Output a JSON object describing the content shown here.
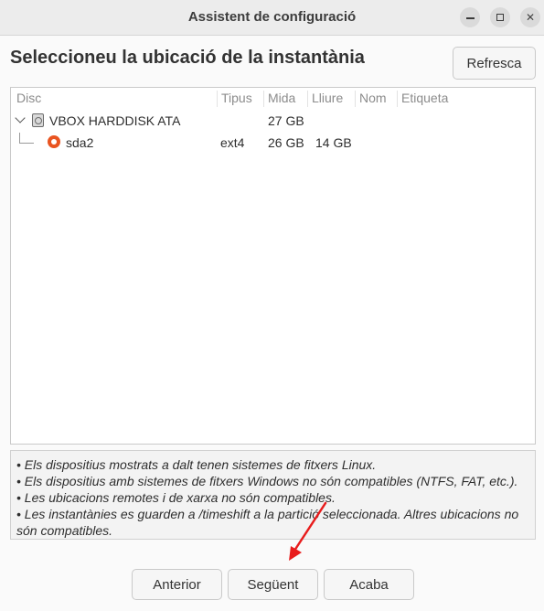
{
  "window": {
    "title": "Assistent de configuració"
  },
  "header": {
    "heading": "Seleccioneu la ubicació de la instantània",
    "refresh_label": "Refresca"
  },
  "table": {
    "columns": [
      "Disc",
      "Tipus",
      "Mida",
      "Lliure",
      "Nom",
      "Etiqueta"
    ],
    "disk": {
      "name": "VBOX HARDDISK ATA",
      "type": "",
      "size": "27 GB",
      "free": ""
    },
    "partition": {
      "name": "sda2",
      "type": "ext4",
      "size": "26 GB",
      "free": "14 GB",
      "selected": true
    }
  },
  "notes": [
    "• Els dispositius mostrats a dalt tenen sistemes de fitxers Linux.",
    "• Els dispositius amb sistemes de fitxers Windows no són compatibles (NTFS, FAT, etc.).",
    "• Les ubicacions remotes i de xarxa no són compatibles.",
    "• Les instantànies es guarden a /timeshift a la partició seleccionada. Altres ubicacions no són compatibles."
  ],
  "footer": {
    "prev_label": "Anterior",
    "next_label": "Següent",
    "finish_label": "Acaba"
  },
  "colors": {
    "accent": "#e95420",
    "annotation_arrow": "#e81c1c"
  },
  "icons": {
    "disk": "harddisk-icon",
    "partition": "radio-selected-icon",
    "expander": "chevron-down-icon"
  }
}
